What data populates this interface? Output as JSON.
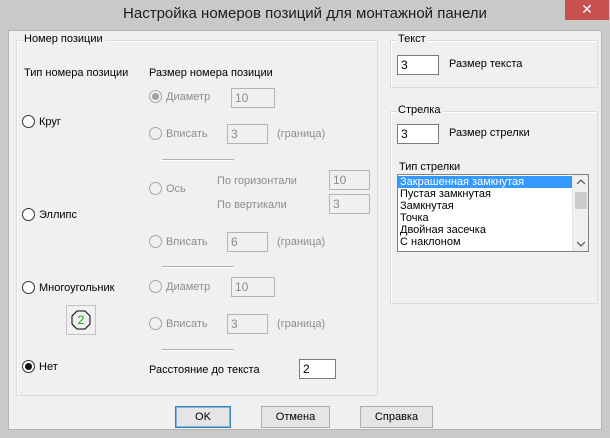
{
  "window": {
    "title": "Настройка номеров позиций для монтажной панели",
    "close_glyph": "✕"
  },
  "position_group": {
    "title": "Номер позиции",
    "type_header": "Тип номера позиции",
    "size_header": "Размер номера позиции",
    "types": {
      "circle": "Круг",
      "ellipse": "Эллипс",
      "polygon": "Многоугольник",
      "none": "Нет"
    },
    "circle": {
      "diameter_label": "Диаметр",
      "diameter_value": "10",
      "fit_label": "Вписать",
      "fit_value": "3",
      "fit_suffix": "(граница)"
    },
    "ellipse": {
      "axis_label": "Ось",
      "horizontal_label": "По горизонтали",
      "horizontal_value": "10",
      "vertical_label": "По вертикали",
      "vertical_value": "3",
      "fit_label": "Вписать",
      "fit_value": "6",
      "fit_suffix": "(граница)"
    },
    "polygon": {
      "preview_number": "2",
      "diameter_label": "Диаметр",
      "diameter_value": "10",
      "fit_label": "Вписать",
      "fit_value": "3",
      "fit_suffix": "(граница)"
    },
    "distance_label": "Расстояние до текста",
    "distance_value": "2"
  },
  "text_group": {
    "title": "Текст",
    "size_value": "3",
    "size_label": "Размер текста"
  },
  "arrow_group": {
    "title": "Стрелка",
    "size_value": "3",
    "size_label": "Размер стрелки",
    "type_label": "Тип стрелки",
    "types": [
      "Закрашенная замкнутая",
      "Пустая замкнутая",
      "Замкнутая",
      "Точка",
      "Двойная засечка",
      "С наклоном"
    ],
    "selected_index": 0
  },
  "buttons": {
    "ok": "OK",
    "cancel": "Отмена",
    "help": "Справка"
  },
  "colors": {
    "selection": "#3399ff",
    "preview_green": "#00b000"
  }
}
